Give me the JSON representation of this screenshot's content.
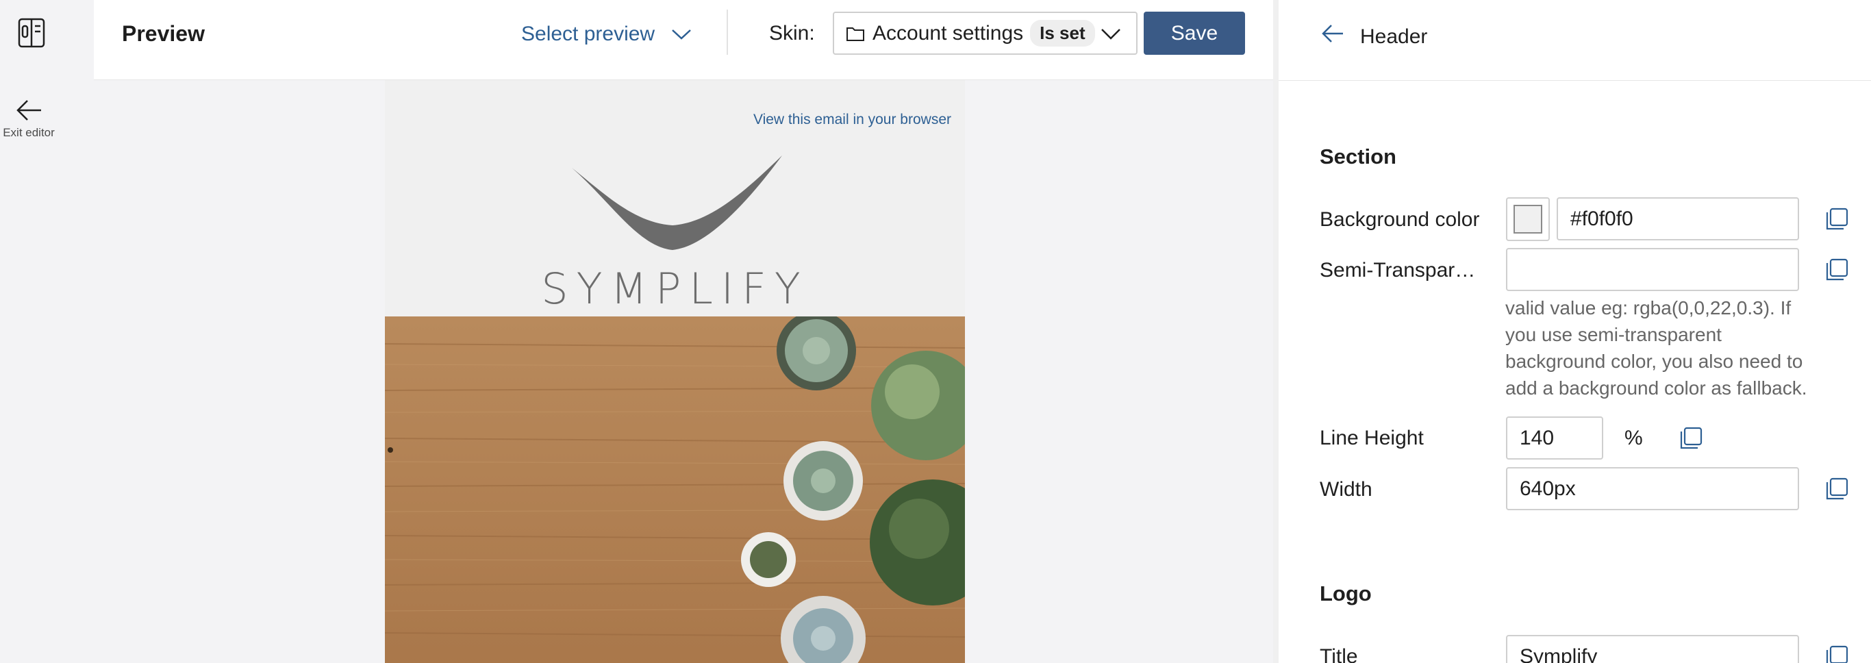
{
  "preview": {
    "title": "Preview",
    "select_preview_label": "Select preview",
    "skin_label": "Skin:",
    "skin_name": "Account settings",
    "skin_badge": "Is set",
    "save_label": "Save"
  },
  "rail": {
    "exit_label": "Exit editor"
  },
  "email": {
    "view_link": "View this email in your browser",
    "logo_text": "SYMPLIFY"
  },
  "panel": {
    "title": "Header",
    "section_title": "Section",
    "background_color_label": "Background color",
    "background_color_value": "#f0f0f0",
    "semi_transparent_label": "Semi-Transpar…",
    "semi_transparent_value": "",
    "semi_transparent_help": "valid value eg: rgba(0,0,22,0.3). If you use semi-transparent background color, you also need to add a background color as fallback.",
    "line_height_label": "Line Height",
    "line_height_value": "140",
    "line_height_unit": "%",
    "width_label": "Width",
    "width_value": "640px",
    "logo_section_title": "Logo",
    "title_label": "Title",
    "title_value": "Symplify"
  },
  "colors": {
    "accent": "#2d5f93",
    "save_button": "#3a5a86",
    "background_swatch": "#f0f0f0"
  },
  "icons": [
    "panel-toggle-icon",
    "arrow-left-icon",
    "chevron-down-icon",
    "folder-icon",
    "copy-icon"
  ]
}
